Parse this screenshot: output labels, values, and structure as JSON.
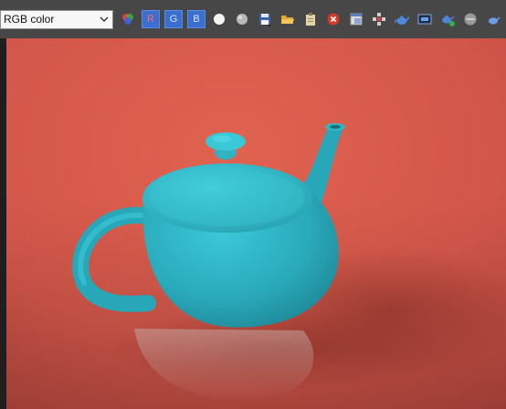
{
  "toolbar": {
    "channel_select": {
      "value": "RGB color"
    },
    "channel_buttons": [
      {
        "label": "R"
      },
      {
        "label": "G"
      },
      {
        "label": "B"
      }
    ],
    "icons": [
      "color-channels-icon",
      "white-circle-icon",
      "gray-circle-icon",
      "save-icon",
      "open-folder-icon",
      "clipboard-icon",
      "close-red-icon",
      "window-icon",
      "tracking-icon",
      "teapot-icon",
      "frame-buffer-icon",
      "teapot-add-icon",
      "gray-disc-icon",
      "teapot-small-icon"
    ]
  },
  "viewport": {
    "background_color": "#d3584a",
    "object": "teapot",
    "object_color": "#2fb4c4"
  }
}
